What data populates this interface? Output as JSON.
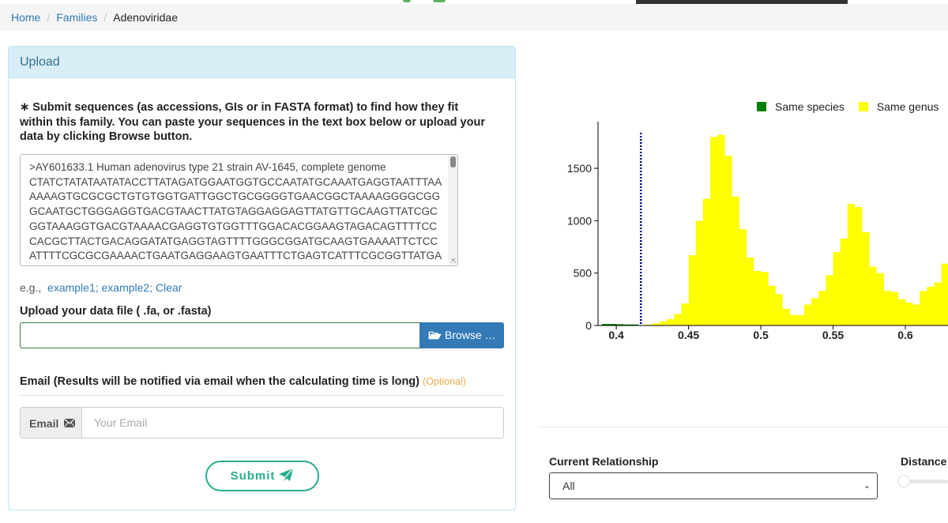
{
  "breadcrumb": {
    "home": "Home",
    "families": "Families",
    "current": "Adenoviridae",
    "separator": "/"
  },
  "upload": {
    "panel_title": "Upload",
    "required_mark": "∗",
    "description": "Submit sequences (as accessions, GIs or in FASTA format) to find how they fit within this family. You can paste your sequences in the text box below or upload your data by clicking Browse button.",
    "sequence_lines": [
      ">AY601633.1 Human adenovirus type 21 strain AV-1645, complete genome",
      "CTATCTATATAATATACCTTATAGATGGAATGGTGCCAATATGCAAATGAGGTAATTTAA",
      "AAAAGTGCGCGCTGTGTGGTGATTGGCTGCGGGGTGAACGGCTAAAAGGGGCGG",
      "GCAATGCTGGGAGGTGACGTAACTTATGTAGGAGGAGTTATGTTGCAAGTTATCGC",
      "GGTAAAGGTGACGTAAAACGAGGTGTGGTTTGGACACGGAAGTAGACAGTTTTCC",
      "CACGCTTACTGACAGGATATGAGGTAGTTTTGGGCGGATGCAAGTGAAAATTCTCC",
      "ATTTTCGCGCGAAAACTGAATGAGGAAGTGAATTTCTGAGTCATTTCGCGGTTATGA"
    ],
    "examples_prefix": "e.g.,",
    "example1": "example1;",
    "example2": "example2;",
    "clear": "Clear",
    "file_label": "Upload your data file ( .fa, or .fasta)",
    "browse_label": "Browse …",
    "email_label": "Email (Results will be notified via email when the calculating time is long)",
    "optional": "(Optional)",
    "email_addon": "Email",
    "email_placeholder": "Your Email",
    "submit_label": "Submit"
  },
  "chart_data": {
    "type": "bar",
    "legend": [
      {
        "name": "Same species",
        "color": "#008000"
      },
      {
        "name": "Same genus",
        "color": "#ffff00"
      }
    ],
    "legend_position": "top-right",
    "x_ticks": [
      "0.4",
      "0.45",
      "0.5",
      "0.55",
      "0.6"
    ],
    "y_ticks": [
      "0",
      "500",
      "1000",
      "1500"
    ],
    "xlim": [
      0.389,
      0.635
    ],
    "ylim": [
      0,
      1900
    ],
    "bin_width": 0.005,
    "marker_line": {
      "x": 0.417,
      "color": "#00008b",
      "style": "dotted"
    },
    "series": [
      {
        "name": "Same species",
        "color": "#008000",
        "x": [
          0.39,
          0.395,
          0.4,
          0.405,
          0.41
        ],
        "values": [
          15,
          15,
          12,
          10,
          10
        ]
      },
      {
        "name": "Same genus",
        "color": "#ffff00",
        "x": [
          0.42,
          0.425,
          0.43,
          0.435,
          0.44,
          0.445,
          0.45,
          0.455,
          0.46,
          0.465,
          0.47,
          0.475,
          0.48,
          0.485,
          0.49,
          0.495,
          0.5,
          0.505,
          0.51,
          0.515,
          0.52,
          0.525,
          0.53,
          0.535,
          0.54,
          0.545,
          0.55,
          0.555,
          0.56,
          0.565,
          0.57,
          0.575,
          0.58,
          0.585,
          0.59,
          0.595,
          0.6,
          0.605,
          0.61,
          0.615,
          0.62,
          0.625,
          0.63
        ],
        "values": [
          10,
          20,
          40,
          60,
          110,
          210,
          670,
          1000,
          1210,
          1800,
          1820,
          1620,
          1230,
          920,
          650,
          520,
          510,
          380,
          300,
          160,
          100,
          100,
          200,
          260,
          330,
          480,
          700,
          830,
          1160,
          1130,
          890,
          560,
          500,
          330,
          320,
          250,
          220,
          200,
          330,
          370,
          410,
          590,
          520
        ]
      }
    ]
  },
  "relationship": {
    "label": "Current Relationship",
    "selected": "All",
    "chevron": "⌄"
  },
  "distance": {
    "label": "Distance",
    "slider_value": 0
  }
}
